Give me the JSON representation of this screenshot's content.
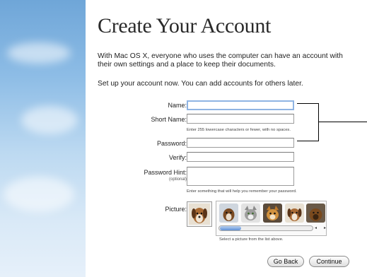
{
  "window": {
    "title": "Create Your Account",
    "intro": "With Mac OS X, everyone who uses the computer can have an account with their own settings and a place to keep their documents.",
    "setup_text": "Set up your account now. You can add accounts for others later."
  },
  "form": {
    "name_label": "Name:",
    "short_name_label": "Short Name:",
    "short_name_hint": "Enter 255 lowercase characters or fewer, with no spaces.",
    "password_label": "Password:",
    "verify_label": "Verify:",
    "password_hint_label": "Password Hint:",
    "optional_label": "(optional)",
    "password_hint_help": "Enter something that will help you remember your password.",
    "picture_label": "Picture:",
    "picture_help": "Select a picture from the list above.",
    "name_value": "",
    "short_name_value": "",
    "password_value": "",
    "verify_value": "",
    "hint_value": ""
  },
  "pictures": [
    "dog-icon",
    "cat-icon",
    "cat-icon",
    "dog-icon",
    "dog-icon"
  ],
  "picture_scroll_position": 0.0,
  "buttons": {
    "back": "Go Back",
    "continue": "Continue"
  },
  "colors": {
    "sky_top": "#6fa6d8",
    "focus_ring": "#8fb4e3"
  }
}
